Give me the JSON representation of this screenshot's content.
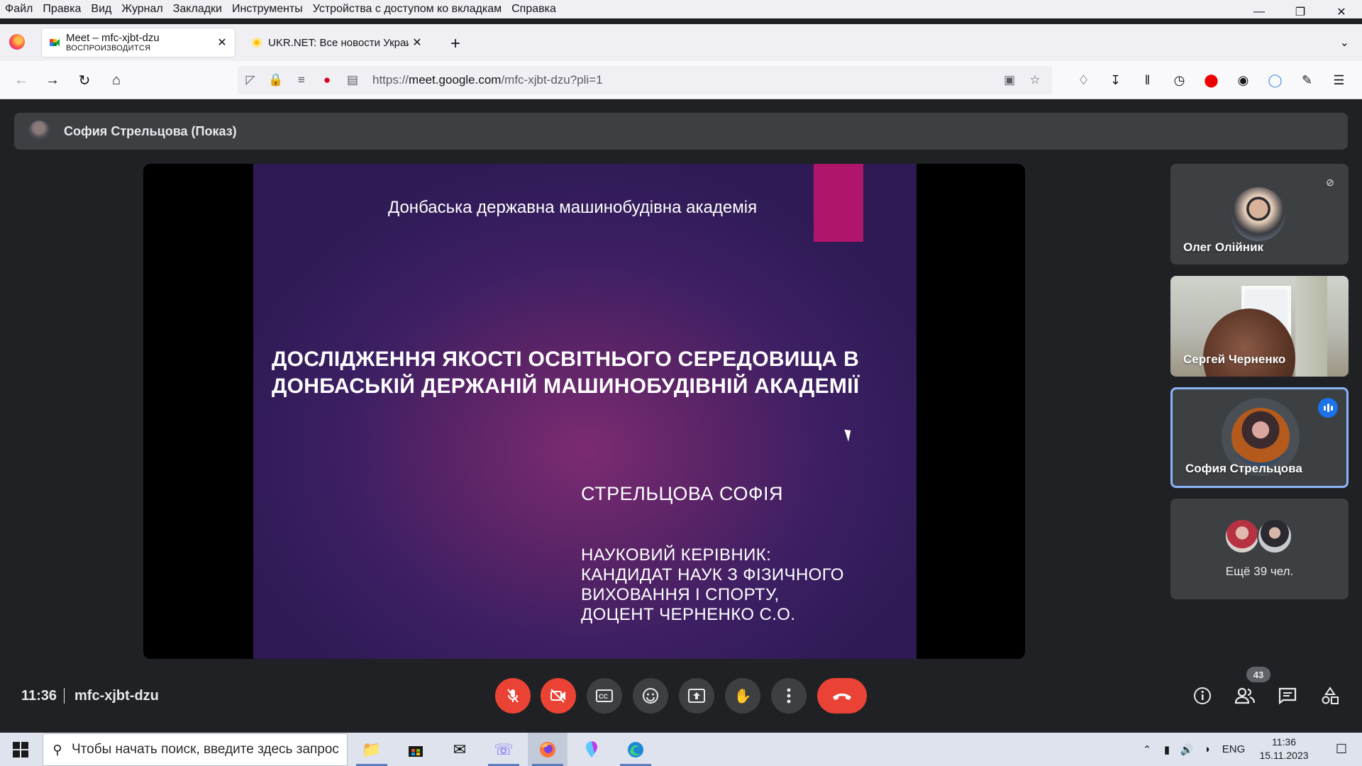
{
  "menubar": {
    "items": [
      "Файл",
      "Правка",
      "Вид",
      "Журнал",
      "Закладки",
      "Инструменты",
      "Устройства с доступом ко вкладкам",
      "Справка"
    ]
  },
  "tabs": [
    {
      "title": "Meet – mfc-xjbt-dzu",
      "subtitle": "ВОСПРОИЗВОДИТСЯ",
      "active": true
    },
    {
      "title": "UKR.NET: Все новости Украин",
      "active": false
    }
  ],
  "url": {
    "prefix": "https://",
    "domain": "meet.google.com",
    "path": "/mfc-xjbt-dzu?pli=1"
  },
  "meet": {
    "presenter_label": "София Стрельцова (Показ)",
    "slide": {
      "org": "Донбаська державна машинобудівна академія",
      "title_line1": "ДОСЛІДЖЕННЯ ЯКОСТІ ОСВІТНЬОГО СЕРЕДОВИЩА В",
      "title_line2": "ДОНБАСЬКІЙ ДЕРЖАНІЙ МАШИНОБУДІВНІЙ АКАДЕМІЇ",
      "author": "СТРЕЛЬЦОВА СОФІЯ",
      "sup_line1": "НАУКОВИЙ КЕРІВНИК:",
      "sup_line2": "КАНДИДАТ НАУК З ФІЗИЧНОГО",
      "sup_line3": "ВИХОВАННЯ І СПОРТУ,",
      "sup_line4": "ДОЦЕНТ ЧЕРНЕНКО С.О.",
      "accent_color": "#b0156c"
    },
    "participants": [
      {
        "name": "Олег Олійник",
        "muted": true
      },
      {
        "name": "Сергей Черненко"
      },
      {
        "name": "София Стрельцова",
        "speaking": true
      },
      {
        "more_label": "Ещё 39 чел."
      }
    ],
    "time": "11:36",
    "code": "mfc-xjbt-dzu",
    "participant_count": "43"
  },
  "taskbar": {
    "search_placeholder": "Чтобы начать поиск, введите здесь запрос",
    "lang": "ENG",
    "time": "11:36",
    "date": "15.11.2023"
  },
  "colors": {
    "meet_bg": "#202124",
    "control_bg": "#3c4043",
    "danger": "#ea4335",
    "speaking": "#1a73e8"
  }
}
